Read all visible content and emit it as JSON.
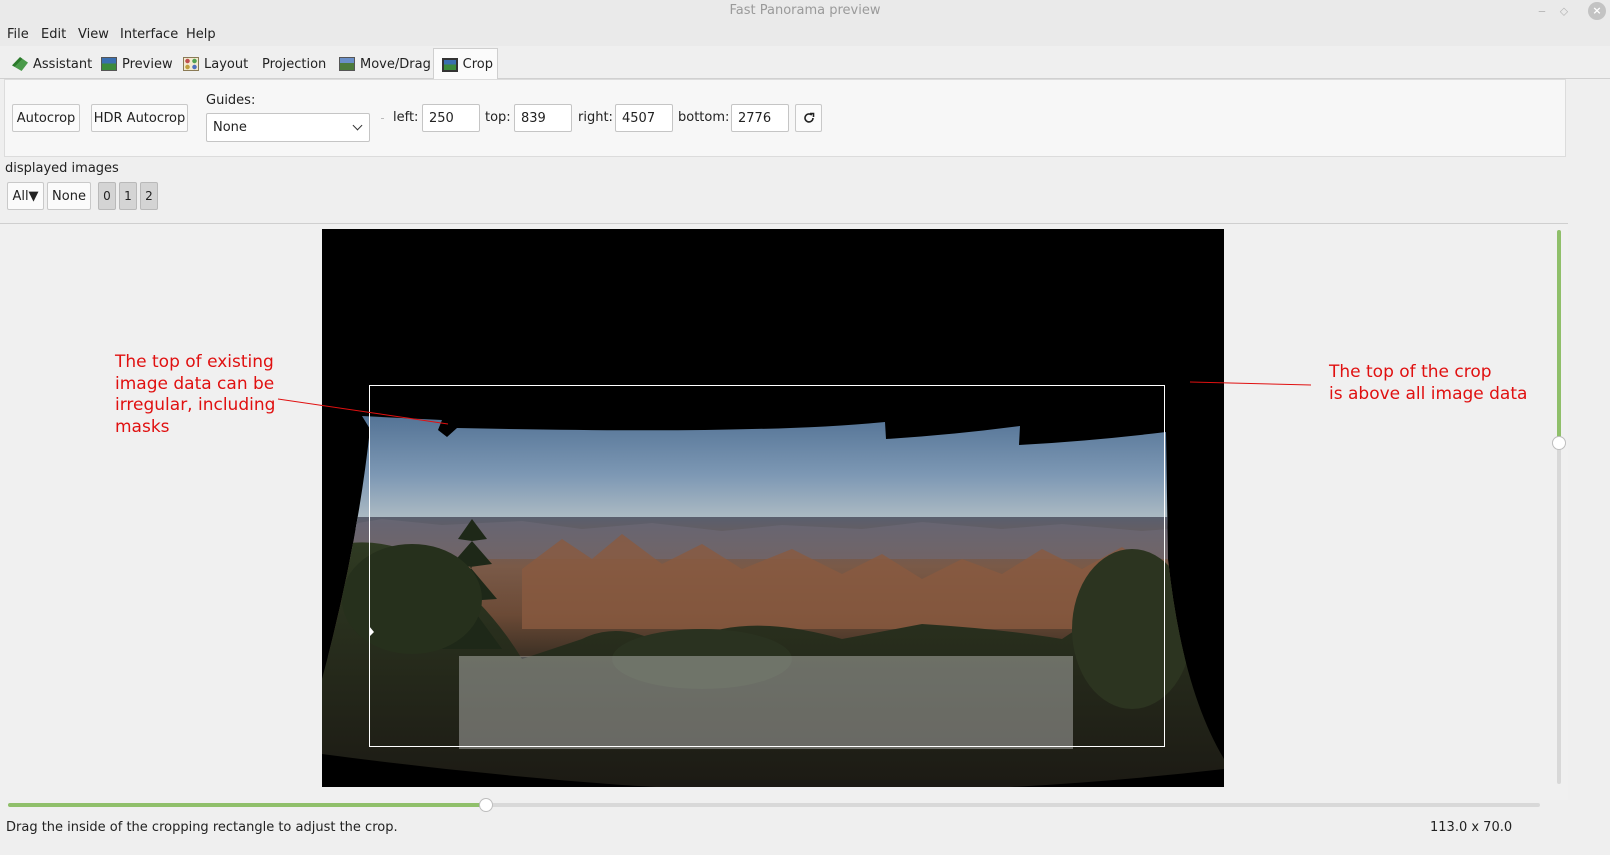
{
  "window": {
    "title": "Fast Panorama preview"
  },
  "menu": [
    "File",
    "Edit",
    "View",
    "Interface",
    "Help"
  ],
  "tabs": [
    {
      "label": "Assistant",
      "icon": "assistant-icon"
    },
    {
      "label": "Preview",
      "icon": "preview-icon"
    },
    {
      "label": "Layout",
      "icon": "layout-icon"
    },
    {
      "label": "Projection",
      "icon": ""
    },
    {
      "label": "Move/Drag",
      "icon": "move-drag-icon"
    },
    {
      "label": "Crop",
      "icon": "crop-icon",
      "active": true
    }
  ],
  "crop": {
    "autocrop_label": "Autocrop",
    "hdr_autocrop_label": "HDR Autocrop",
    "guides_label": "Guides:",
    "guides_value": "None",
    "left_label": "left:",
    "left_value": "250",
    "top_label": "top:",
    "top_value": "839",
    "right_label": "right:",
    "right_value": "4507",
    "bottom_label": "bottom:",
    "bottom_value": "2776",
    "reset_icon": "refresh-icon"
  },
  "displayed_images": {
    "label": "displayed images",
    "all_label": "All▼",
    "none_label": "None",
    "images": [
      "0",
      "1",
      "2"
    ]
  },
  "annotations": {
    "left": [
      "The top of existing",
      "image data can be",
      "irregular, including",
      "masks"
    ],
    "right": [
      "The top of the crop",
      "is above all image data"
    ]
  },
  "status": {
    "message": "Drag the inside of the cropping rectangle to adjust the crop.",
    "fov": "113.0 x 70.0"
  },
  "colors": {
    "annotation": "#e01010",
    "slider_fill": "#8fbf6a"
  },
  "sliders": {
    "vertical_fraction": 0.38,
    "horizontal_fraction": 0.31
  }
}
